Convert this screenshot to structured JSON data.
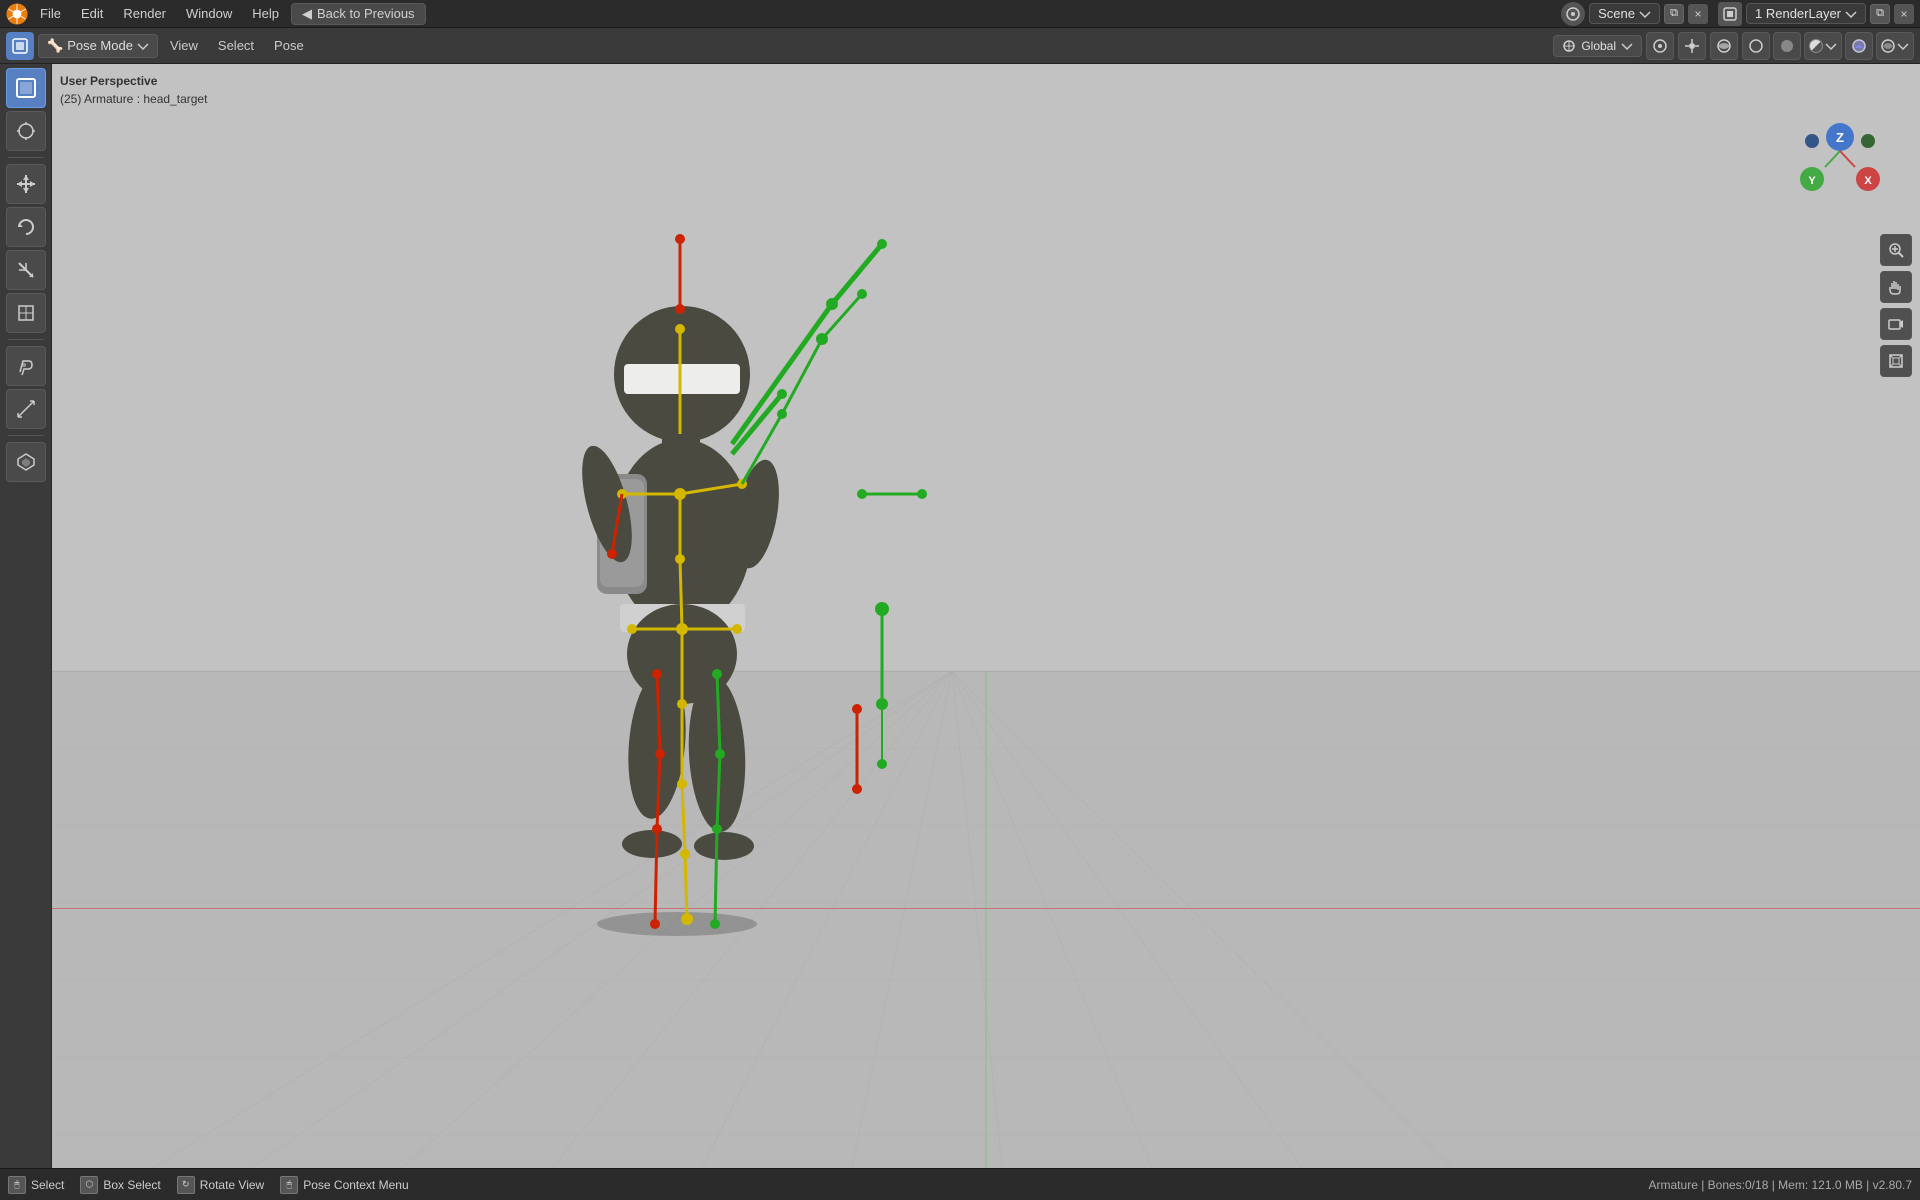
{
  "topbar": {
    "logo_label": "Blender",
    "menu_items": [
      "File",
      "Edit",
      "Render",
      "Window",
      "Help"
    ],
    "back_button_label": "Back to Previous",
    "scene_label": "Scene",
    "render_layer_label": "1 RenderLayer",
    "close_label": "×"
  },
  "toolbar2": {
    "pose_mode_label": "Pose Mode",
    "menu_items": [
      "View",
      "Select",
      "Pose"
    ],
    "transform_label": "Global",
    "select_label": "Select"
  },
  "viewport": {
    "perspective_label": "User Perspective",
    "armature_label": "(25) Armature : head_target",
    "axes": {
      "z_label": "Z",
      "x_label": "X",
      "y_label": "Y"
    }
  },
  "left_sidebar": {
    "tools": [
      {
        "name": "select-box",
        "icon": "⬚",
        "active": true
      },
      {
        "name": "cursor",
        "icon": "⊕"
      },
      {
        "name": "move",
        "icon": "✛"
      },
      {
        "name": "rotate",
        "icon": "↻"
      },
      {
        "name": "scale",
        "icon": "⤢"
      },
      {
        "name": "transform",
        "icon": "⊞"
      },
      {
        "name": "annotate",
        "icon": "✏"
      },
      {
        "name": "measure",
        "icon": "📐"
      },
      {
        "name": "custom",
        "icon": "⬡"
      }
    ]
  },
  "right_icons": [
    {
      "name": "zoom-icon",
      "icon": "🔍"
    },
    {
      "name": "hand-icon",
      "icon": "✋"
    },
    {
      "name": "camera-icon",
      "icon": "🎥"
    },
    {
      "name": "grid-icon",
      "icon": "⊞"
    }
  ],
  "bottom_bar": {
    "select_label": "Select",
    "box_select_label": "Box Select",
    "rotate_view_label": "Rotate View",
    "pose_context_label": "Pose Context Menu",
    "status_label": "Armature | Bones:0/18 | Mem: 121.0 MB | v2.80.7"
  },
  "colors": {
    "background": "#c0c0c0",
    "grid_line": "#aaaaaa",
    "bone_yellow": "#d4b800",
    "bone_red": "#cc2200",
    "bone_green": "#22aa22",
    "accent_blue": "#5680c2"
  }
}
